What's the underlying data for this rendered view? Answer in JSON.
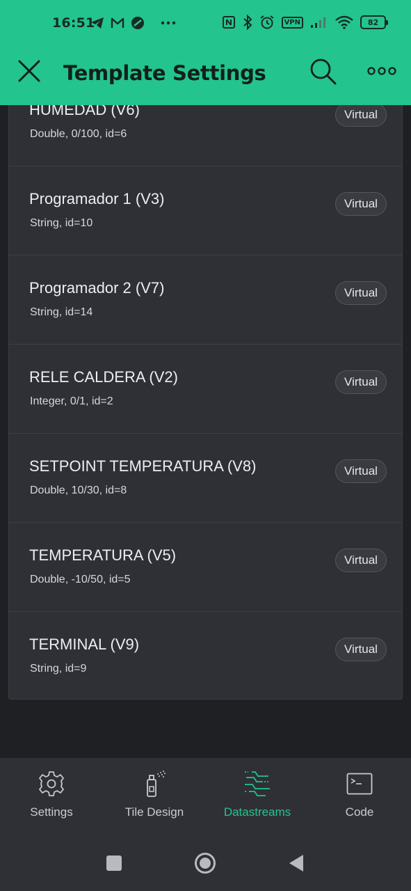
{
  "status_bar": {
    "time": "16:51",
    "battery": "82",
    "left_icons": [
      "telegram-icon",
      "gmail-icon",
      "app-icon",
      "more-dots-icon"
    ],
    "right_icons": [
      "nfc-icon",
      "bluetooth-icon",
      "alarm-icon",
      "vpn-icon",
      "signal-icon",
      "wifi-icon",
      "battery-icon"
    ],
    "vpn_label": "VPN"
  },
  "header": {
    "title": "Template Settings",
    "close_icon": "close-icon",
    "search_icon": "search-icon",
    "more_icon": "more-icon"
  },
  "colors": {
    "accent": "#23c48e",
    "background": "#1f2024",
    "card": "#2f3035"
  },
  "datastreams": [
    {
      "title": "HUMEDAD (V6)",
      "subtitle": "Double, 0/100, id=6",
      "badge": "Virtual"
    },
    {
      "title": "Programador 1 (V3)",
      "subtitle": "String, id=10",
      "badge": "Virtual"
    },
    {
      "title": "Programador 2 (V7)",
      "subtitle": "String, id=14",
      "badge": "Virtual"
    },
    {
      "title": "RELE CALDERA (V2)",
      "subtitle": "Integer, 0/1, id=2",
      "badge": "Virtual"
    },
    {
      "title": "SETPOINT TEMPERATURA (V8)",
      "subtitle": "Double, 10/30, id=8",
      "badge": "Virtual"
    },
    {
      "title": "TEMPERATURA (V5)",
      "subtitle": "Double, -10/50, id=5",
      "badge": "Virtual"
    },
    {
      "title": "TERMINAL (V9)",
      "subtitle": "String, id=9",
      "badge": "Virtual"
    }
  ],
  "bottom_nav": {
    "items": [
      {
        "label": "Settings",
        "icon": "gear-icon",
        "active": false
      },
      {
        "label": "Tile Design",
        "icon": "spray-can-icon",
        "active": false
      },
      {
        "label": "Datastreams",
        "icon": "datastreams-icon",
        "active": true
      },
      {
        "label": "Code",
        "icon": "terminal-icon",
        "active": false
      }
    ]
  },
  "system_nav": {
    "icons": [
      "recents-icon",
      "home-icon",
      "back-icon"
    ]
  }
}
